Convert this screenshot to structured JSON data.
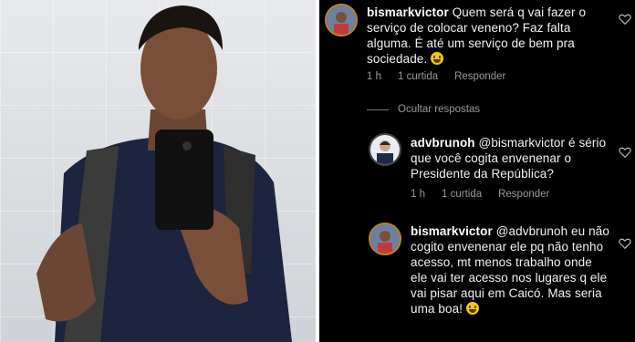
{
  "comments": [
    {
      "username": "bismarkvictor",
      "text": "Quem será q vai fazer o serviço de colocar veneno? Faz falta alguma. É até um serviço de bem pra sociedade.",
      "time": "1 h",
      "likes": "1 curtida",
      "reply": "Responder"
    },
    {
      "username": "advbrunoh",
      "text": "@bismarkvictor é sério que você cogita envenenar o Presidente da República?",
      "time": "1 h",
      "likes": "1 curtida",
      "reply": "Responder"
    },
    {
      "username": "bismarkvictor",
      "text": "@advbrunoh eu não cogito envenenar ele pq não tenho acesso, mt menos trabalho onde ele vai ter acesso nos lugares q ele vai pisar aqui em Caicó. Mas seria uma boa!"
    }
  ],
  "hidden_replies_label": "Ocultar respostas",
  "icons": {
    "like": "heart-icon",
    "emoji": "grinning-face-emoji"
  },
  "colors": {
    "background": "#000000",
    "meta": "#9a9a9a",
    "text": "#f2f2f2"
  }
}
